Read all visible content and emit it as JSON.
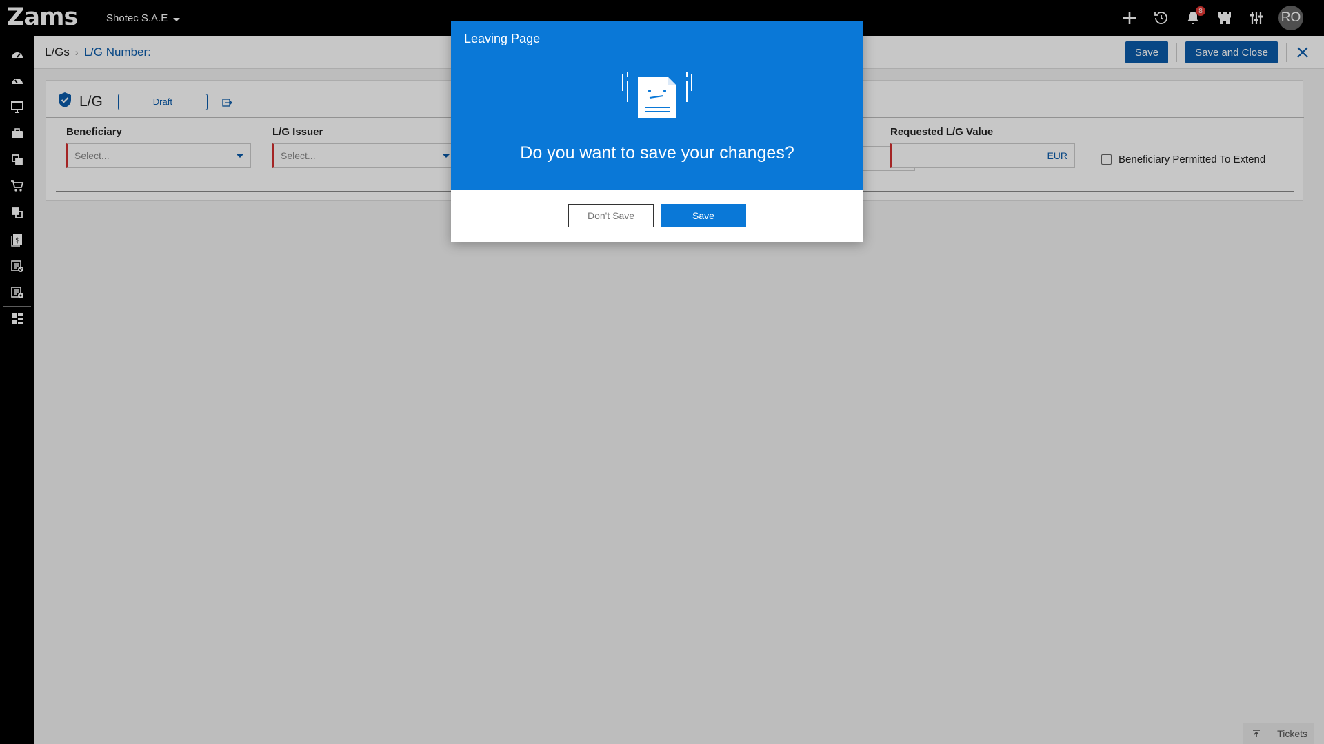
{
  "app": {
    "logo": "Zams",
    "company": "Shotec S.A.E",
    "notifications_count": "8",
    "user_initials": "RO"
  },
  "breadcrumb": {
    "root": "L/Gs",
    "current": "L/G Number:"
  },
  "header_actions": {
    "save_label": "Save",
    "save_close_label": "Save and Close"
  },
  "form": {
    "title": "L/G",
    "status": "Draft",
    "beneficiary": {
      "label": "Beneficiary",
      "placeholder": "Select..."
    },
    "issuer": {
      "label": "L/G Issuer",
      "placeholder": "Select..."
    },
    "requested_value": {
      "label": "Requested L/G Value",
      "currency": "EUR"
    },
    "permitted_extend": {
      "label": "Beneficiary Permitted To Extend",
      "checked": false
    }
  },
  "tickets": {
    "label": "Tickets"
  },
  "modal": {
    "title": "Leaving Page",
    "question": "Do you want to save your changes?",
    "dont_save_label": "Don't Save",
    "save_label": "Save"
  },
  "colors": {
    "topbar": "#000000",
    "brand_blue": "#0b5cab",
    "modal_blue": "#0a78d7",
    "required_red": "#d32f2f",
    "badge_red": "#e53935"
  },
  "icons": {
    "topbar": [
      "plus-icon",
      "history-icon",
      "bell-icon",
      "castle-icon",
      "sliders-icon"
    ],
    "sidebar": [
      "dashboard-icon",
      "dashboard-alt-icon",
      "monitor-icon",
      "briefcase-icon",
      "documents-icon",
      "cart-icon",
      "documents-alt-icon",
      "invoice-dollar-icon",
      "checklist-icon",
      "settings-list-icon",
      "grid-apps-icon"
    ]
  }
}
